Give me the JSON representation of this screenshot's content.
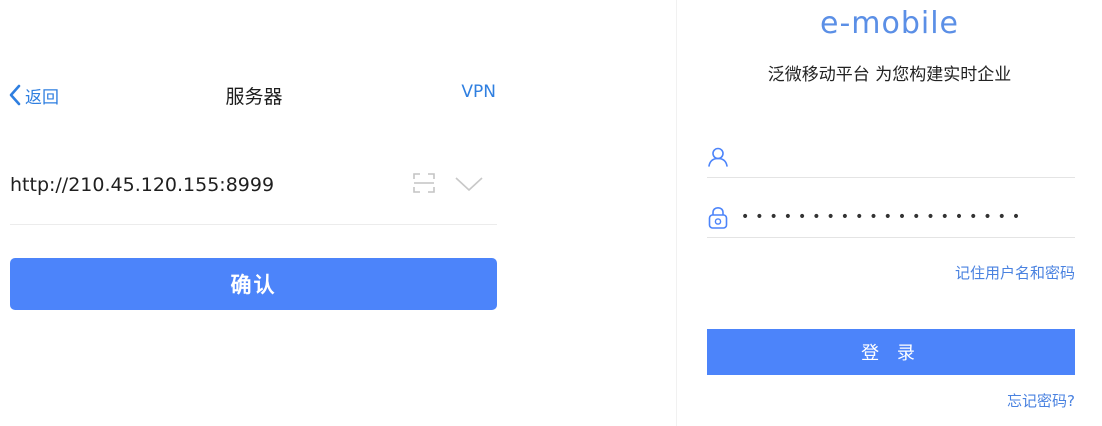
{
  "server_page": {
    "nav": {
      "back_label": "返回",
      "title": "服务器",
      "vpn_label": "VPN"
    },
    "server_address": {
      "value": "http://210.45.120.155:8999"
    },
    "confirm_label": "确认"
  },
  "login_page": {
    "logo_text": "e-mobile",
    "slogan": "泛微移动平台 为您构建实时企业",
    "username": {
      "value": "",
      "icon": "user-icon"
    },
    "password": {
      "value": "••••••••••••••••••••",
      "icon": "lock-icon"
    },
    "remember_label": "记住用户名和密码",
    "login_label": "登 录",
    "forgot_label": "忘记密码?"
  },
  "colors": {
    "accent": "#4c84fa",
    "link": "#2f7fe0"
  }
}
